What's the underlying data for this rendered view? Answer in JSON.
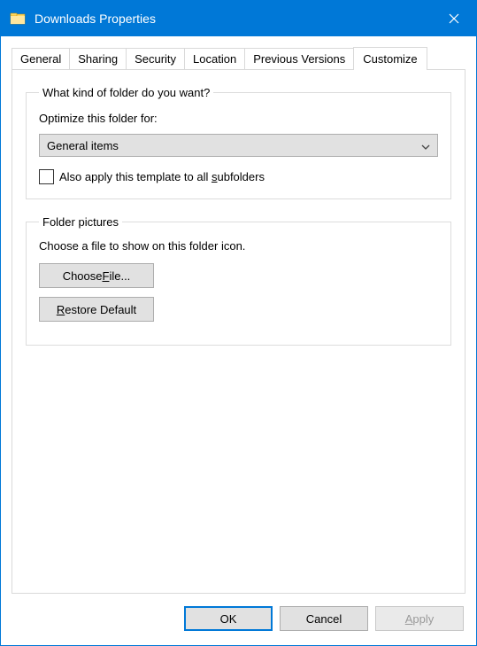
{
  "window": {
    "title": "Downloads Properties"
  },
  "tabs": {
    "items": [
      "General",
      "Sharing",
      "Security",
      "Location",
      "Previous Versions",
      "Customize"
    ],
    "active_index": 5
  },
  "customize": {
    "section1": {
      "legend": "What kind of folder do you want?",
      "optimize_label": "Optimize this folder for:",
      "dropdown_value": "General items",
      "checkbox_checked": false,
      "checkbox_prefix": "Also apply this template to all ",
      "checkbox_underlined": "s",
      "checkbox_suffix": "ubfolders"
    },
    "section2": {
      "legend": "Folder pictures",
      "desc": "Choose a file to show on this folder icon.",
      "choose_prefix": "Choose ",
      "choose_underlined": "F",
      "choose_suffix": "ile...",
      "restore_underlined": "R",
      "restore_suffix": "estore Default"
    }
  },
  "footer": {
    "ok": "OK",
    "cancel": "Cancel",
    "apply_underlined": "A",
    "apply_suffix": "pply"
  }
}
